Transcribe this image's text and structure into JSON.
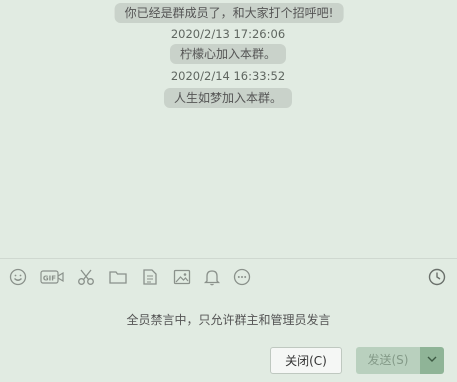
{
  "chat": {
    "messages": [
      {
        "type": "system",
        "text": "你已经是群成员了，和大家打个招呼吧!"
      },
      {
        "type": "time",
        "text": "2020/2/13 17:26:06"
      },
      {
        "type": "system",
        "text": "柠檬心加入本群。"
      },
      {
        "type": "time",
        "text": "2020/2/14 16:33:52"
      },
      {
        "type": "system",
        "text": "人生如梦加入本群。"
      }
    ]
  },
  "toolbar": {
    "icons": [
      "emoji-icon",
      "gif-icon",
      "scissors-icon",
      "folder-icon",
      "document-icon",
      "image-icon",
      "bell-icon",
      "more-icon",
      "history-clock-icon"
    ],
    "gif_label": "GIF"
  },
  "input_area": {
    "notice": "全员禁言中，只允许群主和管理员发言"
  },
  "footer": {
    "close_label": "关闭(C)",
    "send_label": "发送(S)"
  },
  "colors": {
    "background": "#e1ebe2",
    "system_bubble": "#c9d2ca",
    "send_button": "#b9d0be",
    "send_dropdown": "#8fb497"
  }
}
